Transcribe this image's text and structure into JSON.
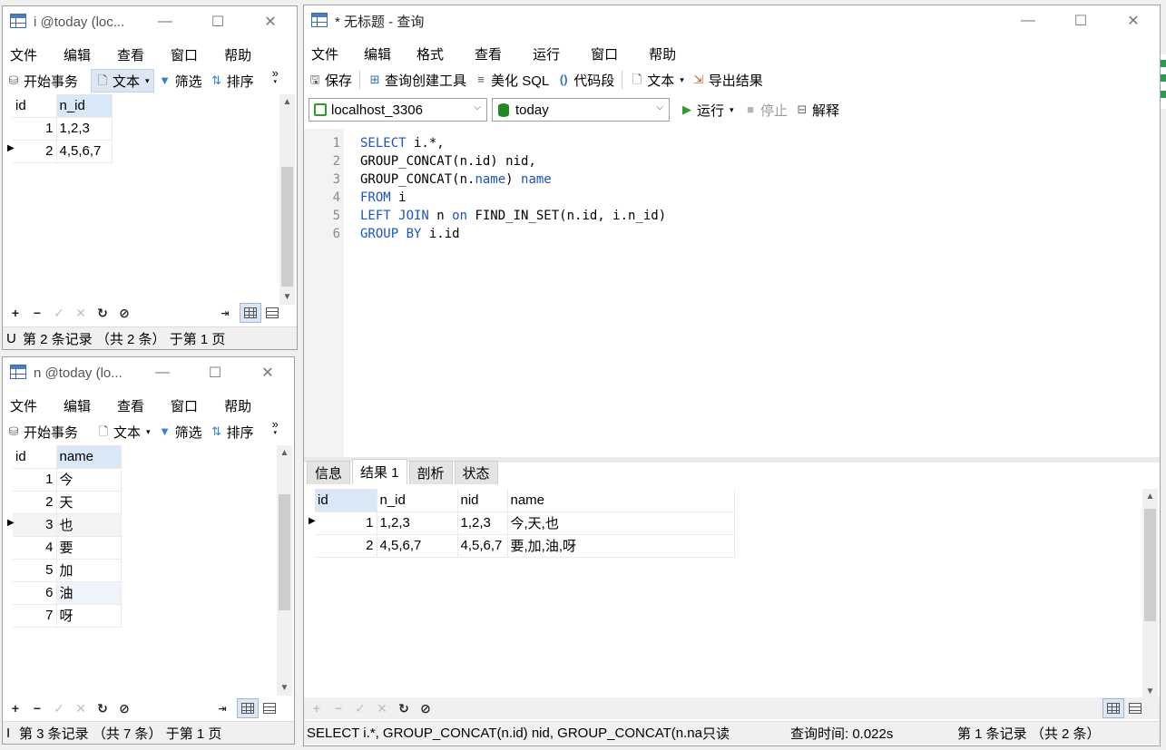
{
  "colors": {
    "keyword": "#1a52d0",
    "header_selected": "#d9e8f7",
    "pressed": "#dde6f2",
    "run_green": "#2a9d2a",
    "db_green": "#1f8a1f"
  },
  "win_i": {
    "title": "i @today (loc...",
    "menu": [
      "文件",
      "编辑",
      "查看",
      "窗口",
      "帮助"
    ],
    "toolbar": {
      "begin": "开始事务",
      "text": "文本",
      "filter": "筛选",
      "sort": "排序",
      "more": "»"
    },
    "columns": [
      "id",
      "n_id"
    ],
    "rows": [
      {
        "id": "1",
        "n_id": "1,2,3"
      },
      {
        "id": "2",
        "n_id": "4,5,6,7"
      }
    ],
    "status_prefix": "U",
    "status": "第 2 条记录 （共 2 条） 于第 1 页"
  },
  "win_n": {
    "title": "n @today (lo...",
    "menu": [
      "文件",
      "编辑",
      "查看",
      "窗口",
      "帮助"
    ],
    "toolbar": {
      "begin": "开始事务",
      "text": "文本",
      "filter": "筛选",
      "sort": "排序",
      "more": "»"
    },
    "columns": [
      "id",
      "name"
    ],
    "rows": [
      {
        "id": "1",
        "name": "今"
      },
      {
        "id": "2",
        "name": "天"
      },
      {
        "id": "3",
        "name": "也"
      },
      {
        "id": "4",
        "name": "要"
      },
      {
        "id": "5",
        "name": "加"
      },
      {
        "id": "6",
        "name": "油"
      },
      {
        "id": "7",
        "name": "呀"
      }
    ],
    "status_prefix": "I",
    "status": "第 3 条记录 （共 7 条） 于第 1 页"
  },
  "win_q": {
    "title": "* 无标题 - 查询",
    "menu": [
      "文件",
      "编辑",
      "格式",
      "查看",
      "运行",
      "窗口",
      "帮助"
    ],
    "toolbar": {
      "save": "保存",
      "builder": "查询创建工具",
      "beautify": "美化 SQL",
      "snippet": "代码段",
      "text": "文本",
      "export": "导出结果"
    },
    "connection": "localhost_3306",
    "database": "today",
    "run": "运行",
    "stop": "停止",
    "explain": "解释",
    "sql_lines": [
      {
        "n": "1",
        "parts": [
          {
            "k": true,
            "t": "SELECT"
          },
          {
            "k": false,
            "t": " i.*,"
          }
        ]
      },
      {
        "n": "2",
        "parts": [
          {
            "k": false,
            "t": "GROUP_CONCAT(n.id) nid,"
          }
        ]
      },
      {
        "n": "3",
        "parts": [
          {
            "k": false,
            "t": "GROUP_CONCAT(n."
          },
          {
            "k": true,
            "t": "name"
          },
          {
            "k": false,
            "t": ") "
          },
          {
            "k": true,
            "t": "name"
          }
        ]
      },
      {
        "n": "4",
        "parts": [
          {
            "k": true,
            "t": "FROM"
          },
          {
            "k": false,
            "t": " i"
          }
        ]
      },
      {
        "n": "5",
        "parts": [
          {
            "k": true,
            "t": "LEFT JOIN"
          },
          {
            "k": false,
            "t": " n "
          },
          {
            "k": true,
            "t": "on"
          },
          {
            "k": false,
            "t": " FIND_IN_SET(n.id, i.n_id)"
          }
        ]
      },
      {
        "n": "6",
        "parts": [
          {
            "k": true,
            "t": "GROUP BY"
          },
          {
            "k": false,
            "t": " i.id"
          }
        ]
      }
    ],
    "tabs": [
      "信息",
      "结果 1",
      "剖析",
      "状态"
    ],
    "active_tab": 1,
    "columns": [
      "id",
      "n_id",
      "nid",
      "name"
    ],
    "rows": [
      {
        "id": "1",
        "n_id": "1,2,3",
        "nid": "1,2,3",
        "name": "今,天,也"
      },
      {
        "id": "2",
        "n_id": "4,5,6,7",
        "nid": "4,5,6,7",
        "name": "要,加,油,呀"
      }
    ],
    "status_sql": "SELECT i.*, GROUP_CONCAT(n.id) nid, GROUP_CONCAT(n.na",
    "status_readonly": "只读",
    "status_time": "查询时间: 0.022s",
    "status_records": "第 1 条记录 （共 2 条）"
  }
}
